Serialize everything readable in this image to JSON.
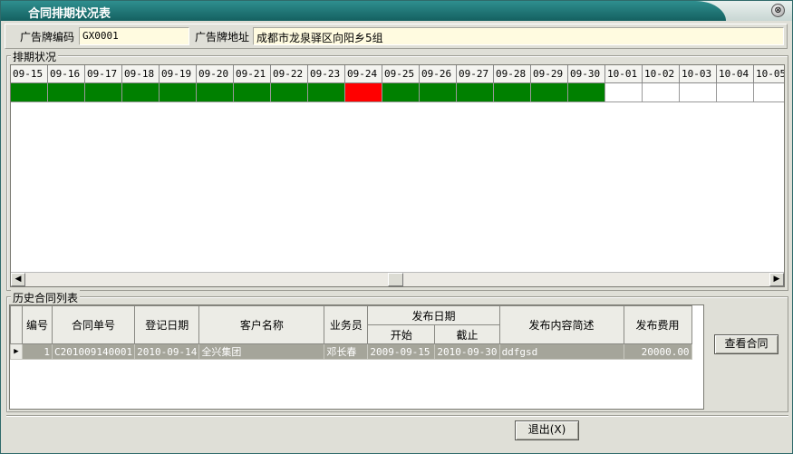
{
  "window": {
    "title": "合同排期状况表",
    "close_glyph": "⊗"
  },
  "billboard": {
    "code_label": "广告牌编码",
    "code_value": "GX0001",
    "address_label": "广告牌地址",
    "address_value": "成都市龙泉驿区向阳乡5组"
  },
  "schedule": {
    "legend": "排期状况",
    "dates": [
      "09-15",
      "09-16",
      "09-17",
      "09-18",
      "09-19",
      "09-20",
      "09-21",
      "09-22",
      "09-23",
      "09-24",
      "09-25",
      "09-26",
      "09-27",
      "09-28",
      "09-29",
      "09-30",
      "10-01",
      "10-02",
      "10-03",
      "10-04",
      "10-05"
    ],
    "status": [
      "booked",
      "booked",
      "booked",
      "booked",
      "booked",
      "booked",
      "booked",
      "booked",
      "booked",
      "conflict",
      "booked",
      "booked",
      "booked",
      "booked",
      "booked",
      "booked",
      "free",
      "free",
      "free",
      "free",
      "free"
    ],
    "colors": {
      "booked": "#008000",
      "conflict": "#ff0000",
      "free": "#ffffff"
    },
    "scroll_left_glyph": "◀",
    "scroll_right_glyph": "▶"
  },
  "history": {
    "legend": "历史合同列表",
    "headers": {
      "no": "编号",
      "contract_no": "合同单号",
      "reg_date": "登记日期",
      "customer": "客户名称",
      "salesman": "业务员",
      "publish_date": "发布日期",
      "start": "开始",
      "end": "截止",
      "content": "发布内容简述",
      "fee": "发布费用"
    },
    "rows": [
      {
        "indicator": "▶",
        "no": "1",
        "contract_no": "C201009140001",
        "reg_date": "2010-09-14",
        "customer": "全兴集团",
        "salesman": "邓长春",
        "start": "2009-09-15",
        "end": "2010-09-30",
        "content": "ddfgsd",
        "fee": "20000.00"
      }
    ],
    "view_button": "查看合同"
  },
  "footer": {
    "exit_button": "退出(X)"
  }
}
